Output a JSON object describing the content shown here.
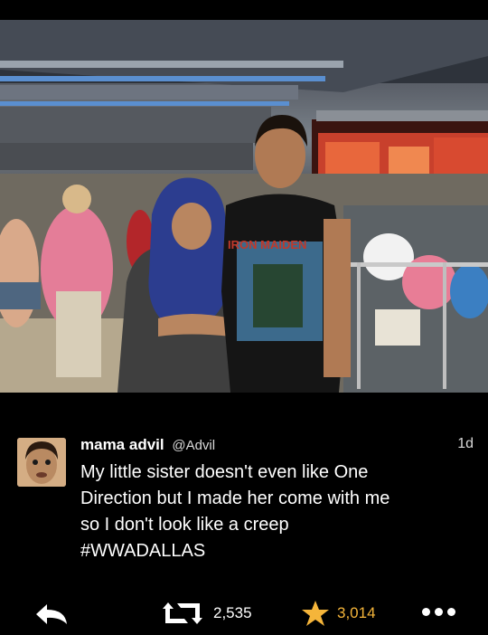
{
  "tweet": {
    "display_name": "mama advil",
    "handle": "@Advil",
    "timestamp": "1d",
    "text_lines": [
      "My little sister doesn't even like One",
      "Direction but I made her come with me",
      "so I don't look like a creep",
      "#WWADALLAS"
    ],
    "retweet_count": "2,535",
    "favorite_count": "3,014"
  },
  "photo": {
    "shirt_text": "IRON MAIDEN"
  },
  "colors": {
    "background": "#000000",
    "favorite": "#f5b53a",
    "text": "#ffffff",
    "muted": "#d9d9d9"
  },
  "icons": {
    "reply": "reply-icon",
    "retweet": "retweet-icon",
    "favorite": "star-icon",
    "more": "more-icon"
  }
}
